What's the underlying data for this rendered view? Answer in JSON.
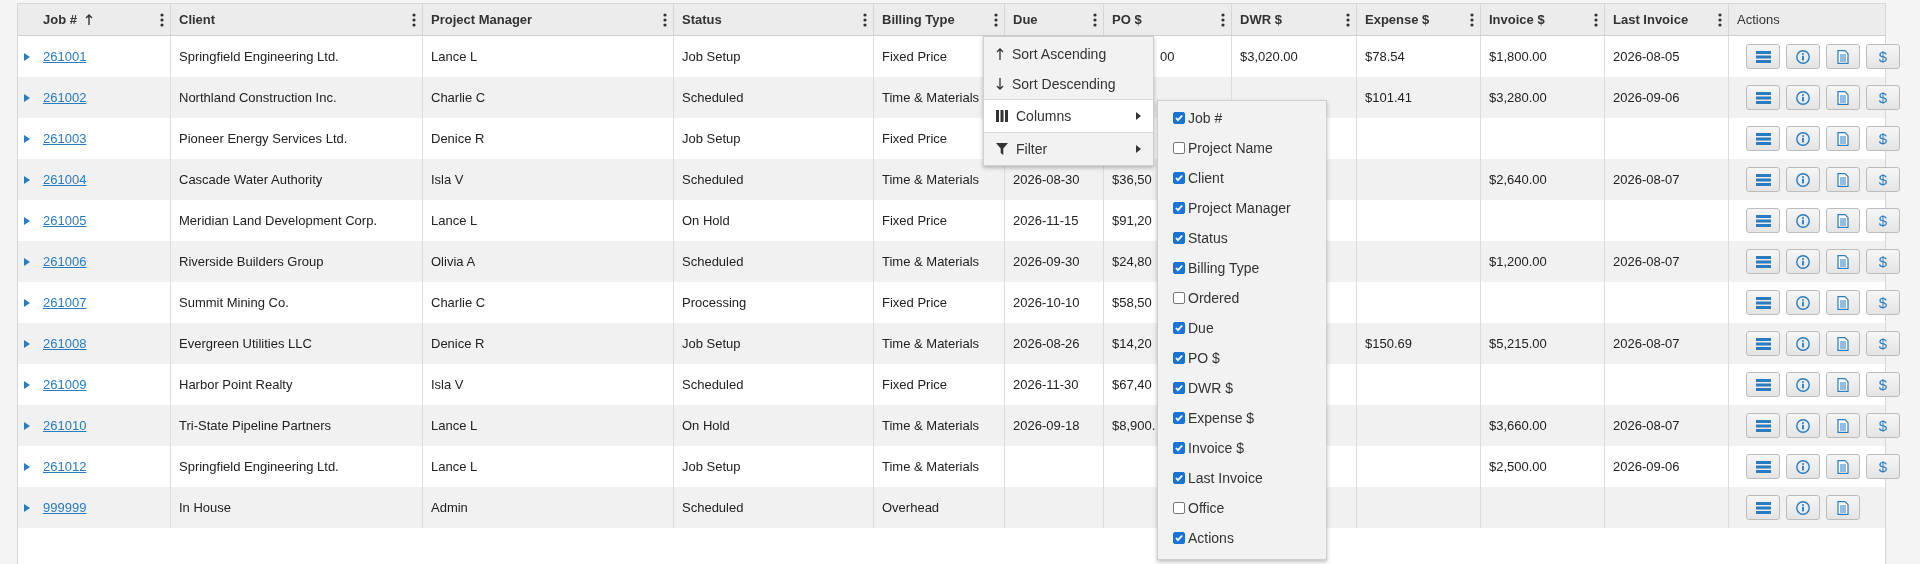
{
  "columns": [
    {
      "label": "Job #",
      "sorted_ascending": true,
      "menu": true
    },
    {
      "label": "Client",
      "sorted_ascending": false,
      "menu": true
    },
    {
      "label": "Project Manager",
      "sorted_ascending": false,
      "menu": true
    },
    {
      "label": "Status",
      "sorted_ascending": false,
      "menu": true
    },
    {
      "label": "Billing Type",
      "sorted_ascending": false,
      "menu": true
    },
    {
      "label": "Due",
      "sorted_ascending": false,
      "menu": true
    },
    {
      "label": "PO $",
      "sorted_ascending": false,
      "menu": true
    },
    {
      "label": "DWR $",
      "sorted_ascending": false,
      "menu": true
    },
    {
      "label": "Expense $",
      "sorted_ascending": false,
      "menu": true
    },
    {
      "label": "Invoice $",
      "sorted_ascending": false,
      "menu": true
    },
    {
      "label": "Last Invoice",
      "sorted_ascending": false,
      "menu": true
    },
    {
      "label": "Actions",
      "sorted_ascending": false,
      "menu": false
    }
  ],
  "rows": [
    {
      "expanded": false,
      "cells": [
        "261001",
        "Springfield Engineering Ltd.",
        "Lance L",
        "Job Setup",
        "Fixed Price",
        null,
        "00",
        "$3,020.00",
        "$78.54",
        "$1,800.00",
        "2026-08-05"
      ],
      "po_partial": true,
      "actions": [
        {
          "kind": "menu"
        },
        {
          "kind": "info"
        },
        {
          "kind": "document"
        },
        {
          "kind": "billing",
          "label": "$"
        }
      ]
    },
    {
      "expanded": false,
      "cells": [
        "261002",
        "Northland Construction Inc.",
        "Charlie C",
        "Scheduled",
        "Time & Materials",
        null,
        null,
        null,
        "$101.41",
        "$3,280.00",
        "2026-09-06"
      ],
      "actions": [
        {
          "kind": "menu"
        },
        {
          "kind": "info"
        },
        {
          "kind": "document"
        },
        {
          "kind": "billing",
          "label": "$"
        }
      ]
    },
    {
      "expanded": false,
      "cells": [
        "261003",
        "Pioneer Energy Services Ltd.",
        "Denice R",
        "Job Setup",
        "Fixed Price",
        null,
        null,
        null,
        null,
        null,
        null
      ],
      "actions": [
        {
          "kind": "menu"
        },
        {
          "kind": "info"
        },
        {
          "kind": "document"
        },
        {
          "kind": "billing",
          "label": "$"
        }
      ]
    },
    {
      "expanded": false,
      "cells": [
        "261004",
        "Cascade Water Authority",
        "Isla V",
        "Scheduled",
        "Time & Materials",
        "2026-08-30",
        "$36,50",
        null,
        null,
        "$2,640.00",
        "2026-08-07"
      ],
      "actions": [
        {
          "kind": "menu"
        },
        {
          "kind": "info"
        },
        {
          "kind": "document"
        },
        {
          "kind": "billing",
          "label": "$"
        }
      ]
    },
    {
      "expanded": false,
      "cells": [
        "261005",
        "Meridian Land Development Corp.",
        "Lance L",
        "On Hold",
        "Fixed Price",
        "2026-11-15",
        "$91,20",
        null,
        null,
        null,
        null
      ],
      "actions": [
        {
          "kind": "menu"
        },
        {
          "kind": "info"
        },
        {
          "kind": "document"
        },
        {
          "kind": "billing",
          "label": "$"
        }
      ]
    },
    {
      "expanded": false,
      "cells": [
        "261006",
        "Riverside Builders Group",
        "Olivia A",
        "Scheduled",
        "Time & Materials",
        "2026-09-30",
        "$24,80",
        null,
        null,
        "$1,200.00",
        "2026-08-07"
      ],
      "actions": [
        {
          "kind": "menu"
        },
        {
          "kind": "info"
        },
        {
          "kind": "document"
        },
        {
          "kind": "billing",
          "label": "$"
        }
      ]
    },
    {
      "expanded": false,
      "cells": [
        "261007",
        "Summit Mining Co.",
        "Charlie C",
        "Processing",
        "Fixed Price",
        "2026-10-10",
        "$58,50",
        null,
        null,
        null,
        null
      ],
      "actions": [
        {
          "kind": "menu"
        },
        {
          "kind": "info"
        },
        {
          "kind": "document"
        },
        {
          "kind": "billing",
          "label": "$"
        }
      ]
    },
    {
      "expanded": false,
      "cells": [
        "261008",
        "Evergreen Utilities LLC",
        "Denice R",
        "Job Setup",
        "Time & Materials",
        "2026-08-26",
        "$14,20",
        null,
        "$150.69",
        "$5,215.00",
        "2026-08-07"
      ],
      "actions": [
        {
          "kind": "menu"
        },
        {
          "kind": "info"
        },
        {
          "kind": "document"
        },
        {
          "kind": "billing",
          "label": "$"
        }
      ]
    },
    {
      "expanded": false,
      "cells": [
        "261009",
        "Harbor Point Realty",
        "Isla V",
        "Scheduled",
        "Fixed Price",
        "2026-11-30",
        "$67,40",
        null,
        null,
        null,
        null
      ],
      "actions": [
        {
          "kind": "menu"
        },
        {
          "kind": "info"
        },
        {
          "kind": "document"
        },
        {
          "kind": "billing",
          "label": "$"
        }
      ]
    },
    {
      "expanded": false,
      "cells": [
        "261010",
        "Tri-State Pipeline Partners",
        "Lance L",
        "On Hold",
        "Time & Materials",
        "2026-09-18",
        "$8,900.",
        null,
        null,
        "$3,660.00",
        "2026-08-07"
      ],
      "actions": [
        {
          "kind": "menu"
        },
        {
          "kind": "info"
        },
        {
          "kind": "document"
        },
        {
          "kind": "billing",
          "label": "$"
        }
      ]
    },
    {
      "expanded": false,
      "cells": [
        "261012",
        "Springfield Engineering Ltd.",
        "Lance L",
        "Job Setup",
        "Time & Materials",
        null,
        null,
        null,
        null,
        "$2,500.00",
        "2026-09-06"
      ],
      "actions": [
        {
          "kind": "menu"
        },
        {
          "kind": "info"
        },
        {
          "kind": "document"
        },
        {
          "kind": "billing",
          "label": "$"
        }
      ]
    },
    {
      "expanded": false,
      "cells": [
        "999999",
        "In House",
        "Admin",
        "Scheduled",
        "Overhead",
        null,
        null,
        null,
        null,
        null,
        null
      ],
      "actions": [
        {
          "kind": "menu"
        },
        {
          "kind": "info"
        },
        {
          "kind": "document"
        }
      ]
    }
  ],
  "column_menu": {
    "items": [
      {
        "kind": "sort_asc",
        "label": "Sort Ascending",
        "selected": false
      },
      {
        "kind": "sort_desc",
        "label": "Sort Descending",
        "selected": false
      },
      {
        "kind": "columns",
        "label": "Columns",
        "selected": true
      },
      {
        "kind": "filter",
        "label": "Filter",
        "selected": false
      }
    ]
  },
  "column_chooser": [
    {
      "label": "Job #",
      "checked": true
    },
    {
      "label": "Project Name",
      "checked": false
    },
    {
      "label": "Client",
      "checked": true
    },
    {
      "label": "Project Manager",
      "checked": true
    },
    {
      "label": "Status",
      "checked": true
    },
    {
      "label": "Billing Type",
      "checked": true
    },
    {
      "label": "Ordered",
      "checked": false
    },
    {
      "label": "Due",
      "checked": true
    },
    {
      "label": "PO $",
      "checked": true
    },
    {
      "label": "DWR $",
      "checked": true
    },
    {
      "label": "Expense $",
      "checked": true
    },
    {
      "label": "Invoice $",
      "checked": true
    },
    {
      "label": "Last Invoice",
      "checked": true
    },
    {
      "label": "Office",
      "checked": false
    },
    {
      "label": "Actions",
      "checked": true
    }
  ]
}
